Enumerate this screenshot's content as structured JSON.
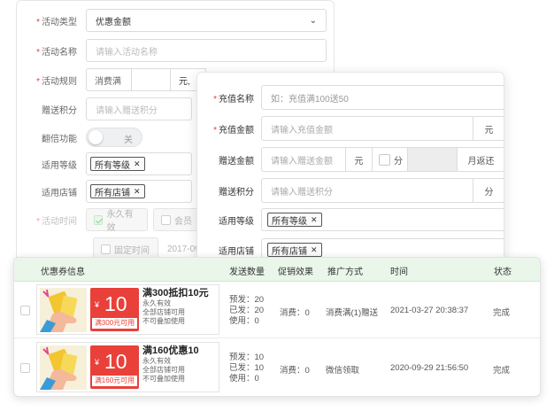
{
  "back_form": {
    "type_label": "活动类型",
    "type_value": "优惠金额",
    "name_label": "活动名称",
    "name_placeholder": "请输入活动名称",
    "rule_label": "活动规则",
    "rule_prefix": "消费满",
    "rule_unit": "元,",
    "gift_points_label": "赠送积分",
    "gift_points_placeholder": "请输入赠送积分",
    "double_label": "翻倍功能",
    "double_toggle": "关",
    "level_label": "适用等级",
    "level_tag": "所有等级",
    "store_label": "适用店铺",
    "store_tag": "所有店铺",
    "time_label": "活动时间",
    "time_permanent": "永久有效",
    "time_member": "会员",
    "time_fixed": "固定时间",
    "time_date": "2017-09"
  },
  "front_form": {
    "recharge_name_label": "充值名称",
    "recharge_name_placeholder": "如：充值满100送50",
    "recharge_amount_label": "充值金额",
    "recharge_amount_placeholder": "请输入充值金额",
    "recharge_amount_unit": "元",
    "gift_amount_label": "赠送金额",
    "gift_amount_placeholder": "请输入赠送金额",
    "gift_amount_unit": "元",
    "split_label": "分",
    "monthly_label": "月返还",
    "gift_points_label": "赠送积分",
    "gift_points_placeholder": "请输入赠送积分",
    "gift_points_unit": "分",
    "level_label": "适用等级",
    "level_tag": "所有等级",
    "store_label": "适用店铺",
    "store_tag": "所有店铺"
  },
  "table": {
    "headers": [
      "优惠券信息",
      "发送数量",
      "促销效果",
      "推广方式",
      "时间",
      "状态"
    ],
    "rows": [
      {
        "amount": "10",
        "currency": "¥",
        "condition": "满300元可用",
        "title": "满300抵扣10元",
        "validity": "永久有效",
        "stores": "全部店铺可用",
        "stackable": "不可叠加使用",
        "presend": "预发：20",
        "sent": "已发：20",
        "used": "使用：0",
        "effect": "消费：0",
        "promo": "消费满(1)赠送",
        "time": "2021-03-27 20:38:37",
        "status": "完成"
      },
      {
        "amount": "10",
        "currency": "¥",
        "condition": "满160元可用",
        "title": "满160优惠10",
        "validity": "永久有效",
        "stores": "全部店铺可用",
        "stackable": "不可叠加使用",
        "presend": "预发：10",
        "sent": "已发：10",
        "used": "使用：0",
        "effect": "消费：0",
        "promo": "微信领取",
        "time": "2020-09-29 21:56:50",
        "status": "完成"
      }
    ]
  },
  "colors": {
    "required": "#e63b3b",
    "coupon_red": "#e9403a",
    "header_green": "#eaf6ea"
  }
}
